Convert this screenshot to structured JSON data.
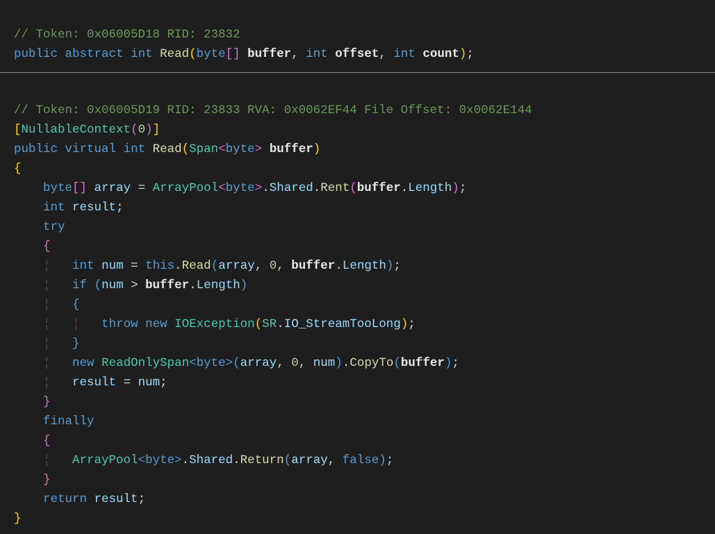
{
  "line1_comment": "// Token: 0x06005D18 RID: 23832",
  "l2_public": "public",
  "l2_abstract": "abstract",
  "l2_int": "int",
  "l2_Read": "Read",
  "l2_byte": "byte",
  "l2_buffer": "buffer",
  "l2_int2": "int",
  "l2_offset": "offset",
  "l2_int3": "int",
  "l2_count": "count",
  "line3_comment": "// Token: 0x06005D19 RID: 23833 RVA: 0x0062EF44 File Offset: 0x0062E144",
  "l4_attr_name": "NullableContext",
  "l4_attr_arg": "0",
  "l5_public": "public",
  "l5_virtual": "virtual",
  "l5_int": "int",
  "l5_Read": "Read",
  "l5_Span": "Span",
  "l5_byte": "byte",
  "l5_buffer": "buffer",
  "l7_byte": "byte",
  "l7_array": "array",
  "l7_ArrayPool": "ArrayPool",
  "l7_byte2": "byte",
  "l7_Shared": "Shared",
  "l7_Rent": "Rent",
  "l7_buffer": "buffer",
  "l7_Length": "Length",
  "l8_int": "int",
  "l8_result": "result",
  "l9_try": "try",
  "l11_int": "int",
  "l11_num": "num",
  "l11_this": "this",
  "l11_Read": "Read",
  "l11_array": "array",
  "l11_zero": "0",
  "l11_buffer": "buffer",
  "l11_Length": "Length",
  "l12_if": "if",
  "l12_num": "num",
  "l12_buffer": "buffer",
  "l12_Length": "Length",
  "l14_throw": "throw",
  "l14_new": "new",
  "l14_IOException": "IOException",
  "l14_SR": "SR",
  "l14_IO_StreamTooLong": "IO_StreamTooLong",
  "l16_new": "new",
  "l16_ReadOnlySpan": "ReadOnlySpan",
  "l16_byte": "byte",
  "l16_array": "array",
  "l16_zero": "0",
  "l16_num": "num",
  "l16_CopyTo": "CopyTo",
  "l16_buffer": "buffer",
  "l17_result": "result",
  "l17_num": "num",
  "l19_finally": "finally",
  "l21_ArrayPool": "ArrayPool",
  "l21_byte": "byte",
  "l21_Shared": "Shared",
  "l21_Return": "Return",
  "l21_array": "array",
  "l21_false": "false",
  "l23_return": "return",
  "l23_result": "result"
}
